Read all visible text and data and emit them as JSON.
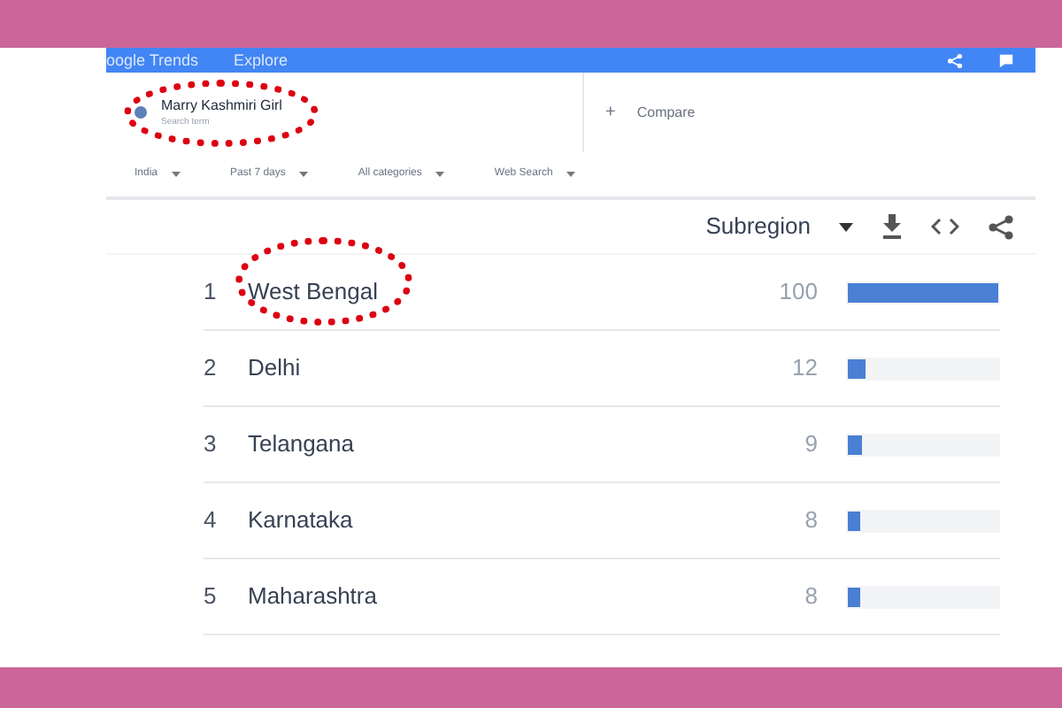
{
  "header": {
    "title": "oogle Trends",
    "nav": "Explore"
  },
  "search_term": {
    "label": "Marry Kashmiri Girl",
    "sublabel": "Search term",
    "circled": true,
    "color": "#5b7fb8"
  },
  "compare": {
    "icon": "+",
    "label": "Compare"
  },
  "filters": [
    {
      "label": "India"
    },
    {
      "label": "Past 7 days"
    },
    {
      "label": "All categories"
    },
    {
      "label": "Web Search"
    }
  ],
  "panel": {
    "dropdown": "Subregion"
  },
  "rows": [
    {
      "rank": "1",
      "name": "West Bengal",
      "value": "100",
      "level": 1.0,
      "circled": true
    },
    {
      "rank": "2",
      "name": "Delhi",
      "value": "12",
      "level": 0.12,
      "circled": false
    },
    {
      "rank": "3",
      "name": "Telangana",
      "value": "9",
      "level": 0.09,
      "circled": false
    },
    {
      "rank": "4",
      "name": "Karnataka",
      "value": "8",
      "level": 0.08,
      "circled": false
    },
    {
      "rank": "5",
      "name": "Maharashtra",
      "value": "8",
      "level": 0.08,
      "circled": false
    }
  ]
}
